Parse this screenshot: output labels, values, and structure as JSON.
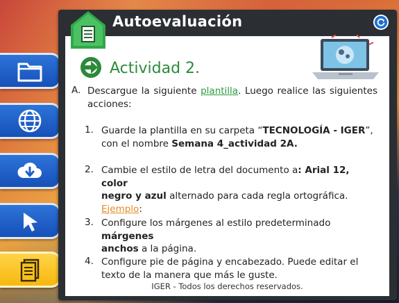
{
  "header": {
    "title": "Autoevaluación"
  },
  "sidebar": {
    "items": [
      {
        "icon": "folder-icon"
      },
      {
        "icon": "globe-icon"
      },
      {
        "icon": "cloud-download-icon"
      },
      {
        "icon": "cursor-icon"
      },
      {
        "icon": "document-icon"
      }
    ]
  },
  "activity": {
    "title": "Actividad 2.",
    "section_marker": "A.",
    "intro_pre": "Descargue la siguiente ",
    "intro_link": "plantilla",
    "intro_post": ". Luego realice las siguientes acciones:",
    "steps": [
      {
        "num": "1.",
        "line1": "Guarde la plantilla en su carpeta “",
        "bold1": "TECNOLOGÍA - IGER",
        "line1b": "”,",
        "line2": "con el nombre ",
        "bold2": "Semana 4_actividad 2A."
      },
      {
        "num": "2.",
        "line1": "Cambie el estilo de letra del documento a",
        "bold1": ": Arial 12, color",
        "bold2": "negro y azul",
        "line2": " alternado para cada regla ortográfica.",
        "link": "Ejemplo",
        "link_post": ":"
      },
      {
        "num": "3.",
        "line1": "Configure los márgenes al estilo predeterminado ",
        "bold1": "márgenes",
        "bold2": "anchos",
        "line2": " a la página."
      },
      {
        "num": "4.",
        "line1": "Configure pie de página y encabezado. Puede editar el",
        "line2": "texto de la manera que más le guste."
      }
    ]
  },
  "footer": {
    "text": "IGER - Todos los derechos reservados."
  },
  "colors": {
    "accent_green": "#2c8a3a",
    "link_orange": "#e48c22",
    "sidebar_blue": "#1a5fc8",
    "sidebar_yellow": "#f6c21a"
  }
}
